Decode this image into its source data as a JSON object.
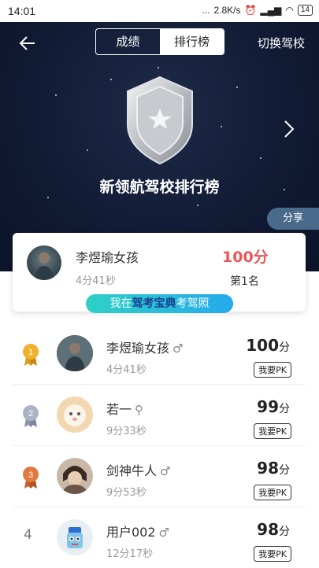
{
  "status": {
    "time": "14:01",
    "dots": "...",
    "speed": "2.8K/s",
    "battery": "14"
  },
  "nav": {
    "tab_scores": "成绩",
    "tab_ranking": "排行榜",
    "switch_school": "切换驾校"
  },
  "hero": {
    "title": "新领航驾校排行榜",
    "share": "分享"
  },
  "my_card": {
    "name": "李煜瑜女孩",
    "time": "4分41秒",
    "score": "100分",
    "rank": "第1名",
    "banner_pre": "我在",
    "banner_brand": "驾考宝典",
    "banner_post": "考驾照"
  },
  "pk_label": "我要PK",
  "score_unit": "分",
  "rows": [
    {
      "rank": "1",
      "name": "李煜瑜女孩",
      "gender": "♂",
      "time": "4分41秒",
      "score": "100"
    },
    {
      "rank": "2",
      "name": "若一",
      "gender": "⚲",
      "time": "9分33秒",
      "score": "99"
    },
    {
      "rank": "3",
      "name": "剑神牛人",
      "gender": "♂",
      "time": "9分53秒",
      "score": "98"
    },
    {
      "rank": "4",
      "name": "用户002",
      "gender": "♂",
      "time": "12分17秒",
      "score": "98"
    }
  ],
  "colors": {
    "accent_red": "#e8565b",
    "gold": "#f0b12e",
    "silver": "#a9b4c6",
    "bronze": "#e07a3f",
    "banner_start": "#2fd0c6",
    "banner_end": "#25a9ec"
  }
}
